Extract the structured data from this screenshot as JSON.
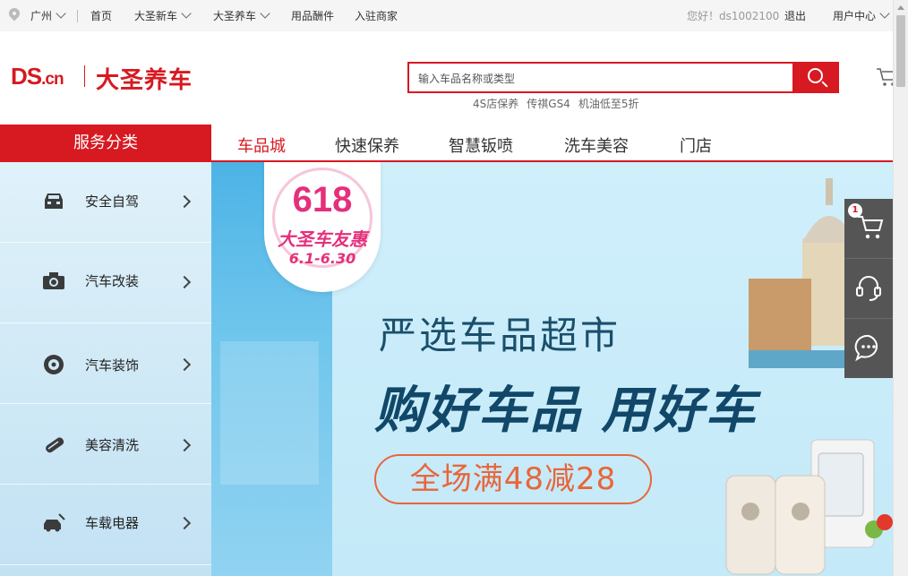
{
  "topbar": {
    "city": "广州",
    "links": [
      "首页",
      "大圣新车",
      "大圣养车",
      "用品酬件",
      "入驻商家"
    ],
    "greeting": "您好！ds1002100",
    "logout": "退出",
    "user_center": "用户中心"
  },
  "header": {
    "logo_text": "DS",
    "logo_domain": ".cn",
    "brand_name": "大圣养车",
    "search_placeholder": "输入车品名称或类型",
    "hot_keywords": [
      "4S店保养",
      "传祺GS4",
      "机油低至5折"
    ]
  },
  "nav": {
    "category_title": "服务分类",
    "items": [
      "车品城",
      "快速保养",
      "智慧钣喷",
      "洗车美容",
      "门店"
    ],
    "active_index": 0
  },
  "sidebar": {
    "categories": [
      {
        "label": "安全自驾",
        "icon": "car-front-icon"
      },
      {
        "label": "汽车改装",
        "icon": "camera-icon"
      },
      {
        "label": "汽车装饰",
        "icon": "wheel-icon"
      },
      {
        "label": "美容清洗",
        "icon": "brush-icon"
      },
      {
        "label": "车载电器",
        "icon": "car-repair-icon"
      }
    ]
  },
  "banner": {
    "badge_number": "618",
    "badge_title": "大圣车友惠",
    "badge_dates": "6.1-6.30",
    "headline": "严选车品超市",
    "slogan": "购好车品 用好车",
    "promo": "全场满48减28"
  },
  "tools": {
    "cart_count": "1",
    "items": [
      "cart-icon",
      "headset-icon",
      "chat-icon"
    ]
  },
  "colors": {
    "brand_red": "#d71921",
    "banner_blue": "#5bbce9",
    "promo_orange": "#e8663b",
    "badge_pink": "#e4307b"
  }
}
